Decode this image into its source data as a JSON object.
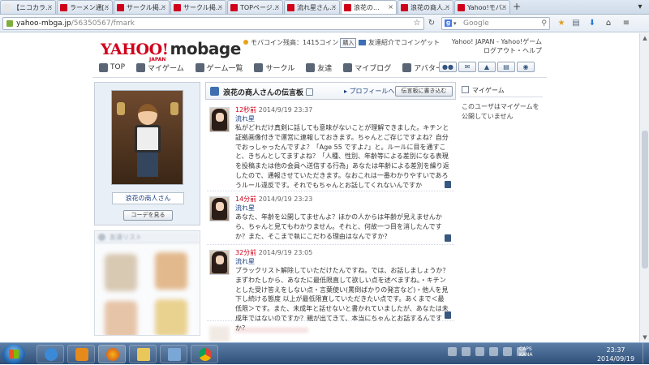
{
  "browser": {
    "tabs": [
      {
        "label": "【ニコカラ...",
        "color": "#e6e6e6",
        "active": false
      },
      {
        "label": "ラーメン通[...",
        "color": "#d0021b",
        "active": false
      },
      {
        "label": "サークル掲...",
        "color": "#d0021b",
        "active": false
      },
      {
        "label": "サークル掲...",
        "color": "#d0021b",
        "active": false
      },
      {
        "label": "TOPページ...",
        "color": "#d0021b",
        "active": false
      },
      {
        "label": "流れ星さん...",
        "color": "#d0021b",
        "active": false
      },
      {
        "label": "浪花の...",
        "color": "#d0021b",
        "active": true
      },
      {
        "label": "浪花の商人...",
        "color": "#d0021b",
        "active": false
      },
      {
        "label": "Yahoo!モバ...",
        "color": "#d0021b",
        "active": false
      }
    ],
    "new_tab": "+",
    "url_host": "yahoo-mbga.jp",
    "url_path": "/56350567/fmark",
    "search_placeholder": "Google",
    "search_engine_letter": "g"
  },
  "header": {
    "logo_yahoo": "YAHOO!",
    "logo_japan": "JAPAN",
    "logo_mobage": "mobage",
    "coins_text": "モバコイン残高：1415コイン",
    "coins_buy": "購入",
    "invite_text": "友達紹介でコインゲット",
    "right_line1": "Yahoo! JAPAN - Yahoo!ゲーム",
    "right_line2": "ログアウト・ヘルプ"
  },
  "nav": {
    "items": [
      "TOP",
      "マイゲーム",
      "ゲーム一覧",
      "サークル",
      "友達",
      "マイブログ",
      "アバター"
    ]
  },
  "profile": {
    "name": "浪花の商人さん",
    "coord_button": "コーデを見る",
    "friends_header": "友達リスト"
  },
  "board": {
    "title": "浪花の商人さんの伝言板",
    "profile_link": "プロフィールへ",
    "write_button": "伝言板に書き込む",
    "posts": [
      {
        "ago": "12秒前",
        "date": "2014/9/19 23:37",
        "author": "流れ星",
        "text": "私がどれだけ真剣に話しても意味がないことが理解できました。キチンと証拠画像付きで運営に連報しておきます。ちゃんとご存じですよね？自分でおっしゃったんですよ？「Age 55 ですよ♪」と。ルールに目を通すこと、きちんとしてますよね？「人種、性別、年齢等による差別になる表現を投稿または他の会員へ送信する行為」あなたは年齢による差別を繰り返したので、通報させていただきます。なおこれは一番わかりやすいであろうルール違反です。それでもちゃんとお話してくれないんですか"
      },
      {
        "ago": "14分前",
        "date": "2014/9/19 23:23",
        "author": "流れ星",
        "text": "あなた、年齢を公開してませんよ？ほかの人からは年齢が見えませんから、ちゃんと見てもわかりません。それと、何故一つ目を消したんですか？また、そこまで執にこだわる理由はなんですか？"
      },
      {
        "ago": "32分前",
        "date": "2014/9/19 23:05",
        "author": "流れ星",
        "text": "ブラックリスト解除していただけたんですね。では、お話しましょうか？まずわたしから、あなたに最低限直して欲しい点を述べますね。・キチンとした受け答えをしない点・言葉使い(罵倒ばかりの発言など)・他人を見下し続ける態度 以上が最低限直していただきたい点です。あくまで＜最低限＞です。また、未成年と話せないと書かれていましたが、あなたは未成年ではないのですか？親が出てきて、本当にちゃんとお話するんですか？"
      }
    ]
  },
  "right": {
    "title": "マイゲーム",
    "empty_text": "このユーザはマイゲームを公開していません"
  },
  "taskbar": {
    "ime_line1": "CAPS",
    "ime_line2": "KANA",
    "time": "23:37",
    "date": "2014/09/19"
  },
  "colors": {
    "brand_red": "#d0021b",
    "link_blue": "#1a3e80",
    "panel_bg": "#e9eff6"
  }
}
